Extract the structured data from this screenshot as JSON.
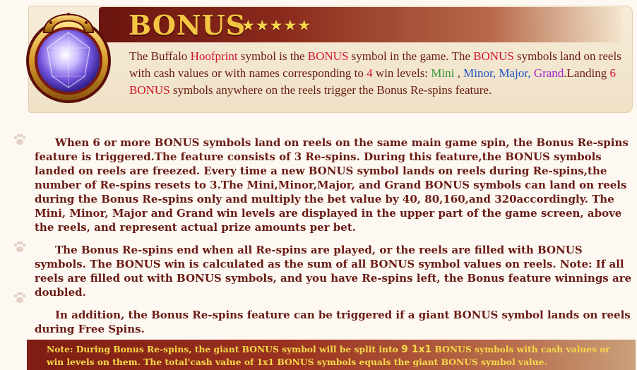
{
  "header": {
    "title": "BONUS",
    "stars": "★★★★★",
    "intro": {
      "p1": "The Buffalo ",
      "hoofprint": "Hoofprint",
      "p2": " symbol is the ",
      "bonus1": "BONUS",
      "p3": " symbol in the game. The ",
      "bonus2": "BONUS",
      "p4": " symbols land on reels with cash values or with names corresponding to ",
      "four": "4",
      "p5": " win levels: ",
      "mini": "Mini",
      "sep1": " , ",
      "minor": "Minor,",
      "sep2": " ",
      "major": "Major,",
      "sep3": " ",
      "grand": "Grand",
      "p6": ".Landing ",
      "six": "6",
      "sep4": " ",
      "bonus3": "BONUS",
      "p7": " symbols anywhere on the reels trigger the Bonus Re-spins feature."
    }
  },
  "body": {
    "paragraphs": [
      "When 6 or more BONUS symbols land on reels on the same main game spin, the Bonus Re-spins feature is triggered.The feature consists of 3 Re-spins. During this feature,the BONUS symbols landed on reels are freezed. Every time a new BONUS symbol lands on reels during Re-spins,the number of Re-spins resets to 3.The Mini,Minor,Major, and Grand BONUS symbols can land on reels during the Bonus Re-spins only and multiply the bet value by 40, 80,160,and 320accordingly. The Mini, Minor, Major and Grand win levels are displayed in the upper part of the game screen, above the reels, and represent actual prize amounts per bet.",
      "The Bonus Re-spins end when all Re-spins are played, or the reels are filled with BONUS symbols. The BONUS win is calculated as the sum of all BONUS symbol values on reels. Note: If all reels are filled out with BONUS symbols, and you have Re-spins left, the Bonus feature winnings are doubled.",
      "In addition, the Bonus Re-spins feature can be triggered if a giant BONUS symbol lands on reels during Free Spins."
    ]
  },
  "note": {
    "p1": "Note: During Bonus Re-spins, the giant BONUS symbol will be split into ",
    "nine": "9 1x1",
    "p2": " BONUS symbols with cash values or win levels on them. The total'cash value of 1x1 BONUS symbols equals the giant BONUS symbol value."
  },
  "icons": {
    "emblem": "horseshoe-gem-icon",
    "paw": "paw-print-icon"
  },
  "colors": {
    "text": "#6a1a14",
    "accent_red": "#d2142a",
    "mini": "#3f9a3b",
    "minor_major": "#1e55c8",
    "grand": "#a324c8",
    "title_gold": "#f4c542",
    "note_text": "#f6d94a"
  }
}
